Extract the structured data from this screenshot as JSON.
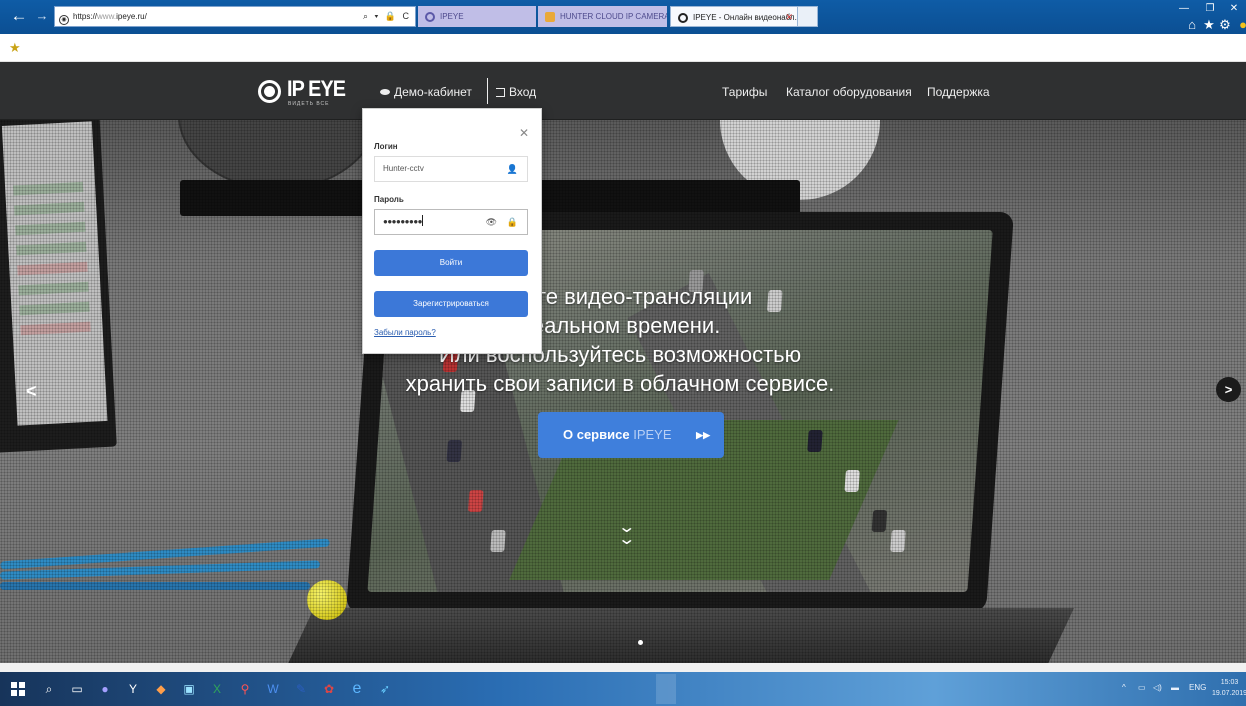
{
  "browser": {
    "url_prefix": "https://",
    "url_www": "www.",
    "url_domain": "ipeye.ru/",
    "address_controls": "⌕ ▾ 🔒 C",
    "tabs": [
      {
        "label": "IPEYE"
      },
      {
        "label": "HUNTER CLOUD IP CAMERA"
      },
      {
        "label": "IPEYE - Онлайн видеонабл..."
      }
    ],
    "close_glyph": "✕"
  },
  "site": {
    "logo_text": "IP EYE",
    "logo_sub": "ВИДЕТЬ ВСЕ",
    "nav": {
      "demo": "Демо-кабинет",
      "login": "Вход",
      "tariffs": "Тарифы",
      "catalog": "Каталог оборудования",
      "support": "Поддержка"
    },
    "hero": {
      "line1": "вляйте видео-трансляции",
      "line2": "реальном времени.",
      "line3": "Или воспользуйтесь возможностью",
      "line4": "хранить свои записи в облачном сервисе.",
      "btn_prefix": "О сервисе",
      "btn_brand": "IPEYE"
    }
  },
  "login": {
    "login_label": "Логин",
    "login_value": "Hunter-cctv",
    "password_label": "Пароль",
    "password_mask": "●●●●●●●●●",
    "submit": "Войти",
    "register": "Зарегистрироваться",
    "forgot": "Забыли пароль?"
  },
  "taskbar": {
    "lang": "ENG",
    "time": "15:03",
    "date": "19.07.2019"
  }
}
